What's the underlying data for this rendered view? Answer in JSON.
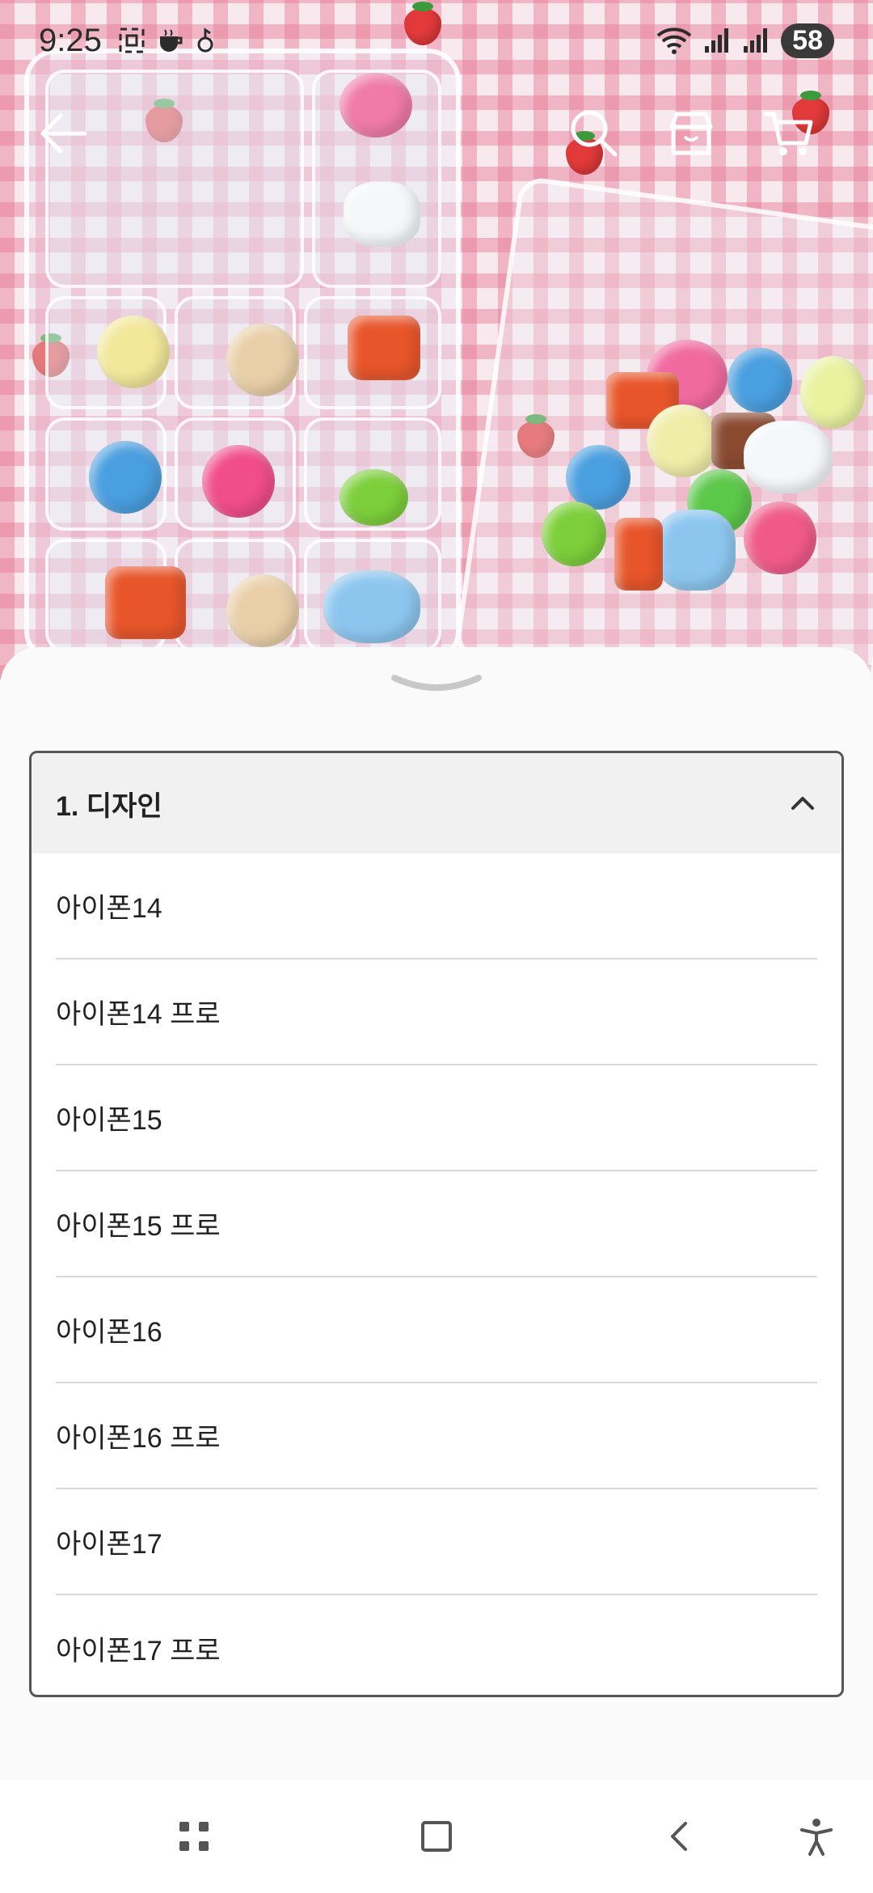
{
  "status_bar": {
    "time": "9:25",
    "battery": "58",
    "icons_left": [
      "screenshot-icon",
      "coffee-icon",
      "notification-icon"
    ],
    "icons_right": [
      "wifi-icon",
      "signal-icon",
      "signal-icon"
    ]
  },
  "top_nav": {
    "back_icon": "arrow-left-icon",
    "search_icon": "search-icon",
    "store_icon": "store-icon",
    "cart_icon": "cart-icon"
  },
  "sheet": {
    "handle_icon": "chevron-down-icon",
    "option_group": {
      "title": "1. 디자인",
      "toggle_icon": "chevron-up-icon",
      "items": [
        "아이폰14",
        "아이폰14 프로",
        "아이폰15",
        "아이폰15 프로",
        "아이폰16",
        "아이폰16 프로",
        "아이폰17",
        "아이폰17 프로"
      ]
    }
  },
  "system_nav": {
    "recents_icon": "recents-icon",
    "home_icon": "home-icon",
    "back_icon": "back-icon",
    "accessibility_icon": "accessibility-icon"
  },
  "colors": {
    "sheet_bg": "#fafafa",
    "header_bg": "#f1f1f1",
    "border": "#555555",
    "divider": "#d8d8d8",
    "text": "#222222"
  }
}
